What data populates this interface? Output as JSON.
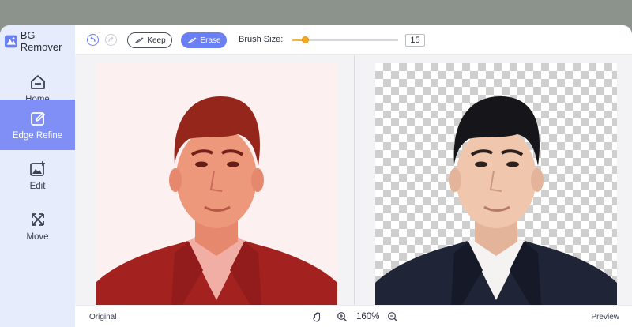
{
  "app": {
    "title": "BG Remover"
  },
  "sidebar": {
    "items": [
      {
        "label": "Home",
        "icon": "home-icon",
        "active": false
      },
      {
        "label": "Edge Refine",
        "icon": "edit-square-icon",
        "active": true
      },
      {
        "label": "Edit",
        "icon": "image-edit-icon",
        "active": false
      },
      {
        "label": "Move",
        "icon": "move-arrows-icon",
        "active": false
      }
    ]
  },
  "toolbar": {
    "keep_label": "Keep",
    "erase_label": "Erase",
    "brush_size_label": "Brush Size:",
    "brush_size_value": "15",
    "brush_size_fraction": 0.12
  },
  "bottombar": {
    "original_label": "Original",
    "preview_label": "Preview",
    "zoom_level": "160%"
  },
  "colors": {
    "accent": "#6b7ff5",
    "sidebar_bg": "#e6ecfb",
    "active_item": "#7f8ff6",
    "slider_thumb": "#f4a823",
    "mask_overlay": "#e0453a"
  }
}
